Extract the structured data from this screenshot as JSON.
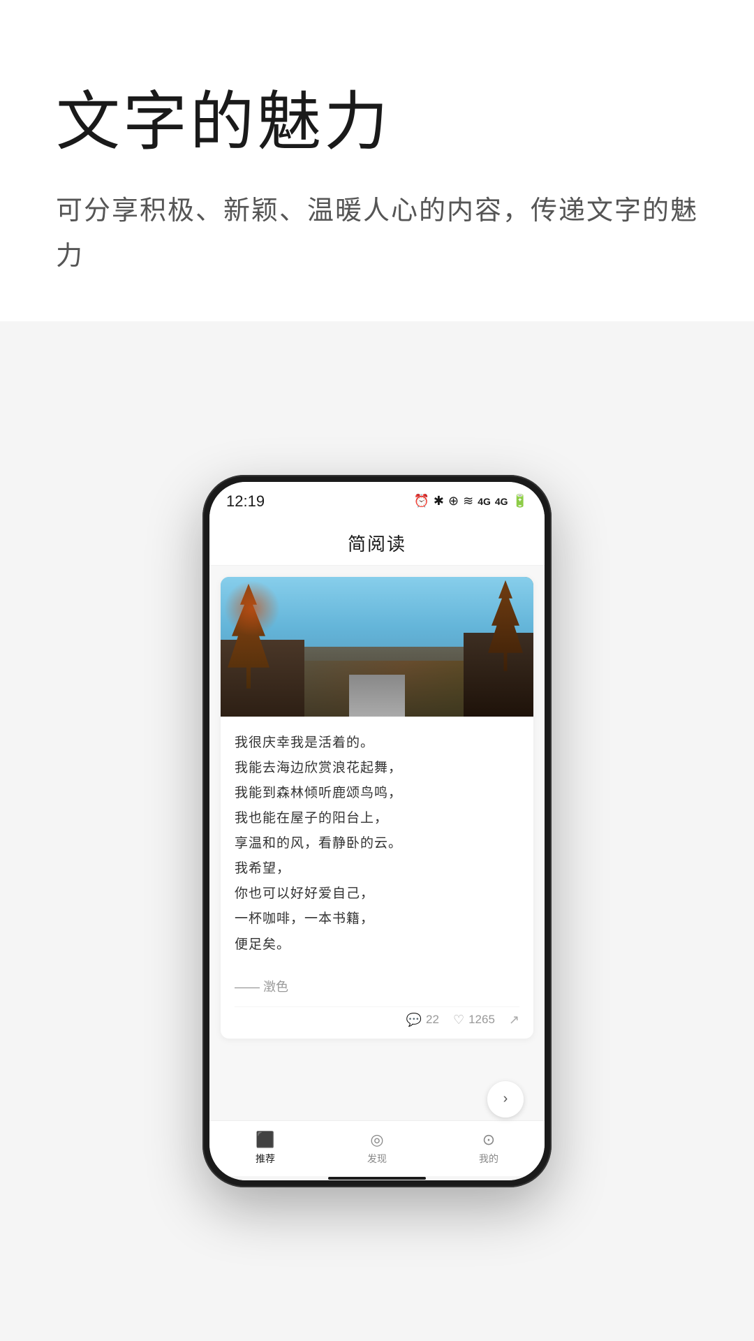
{
  "hero": {
    "title": "文字的魅力",
    "subtitle": "可分享积极、新颖、温暖人心的内容，传递文字的魅力"
  },
  "phone": {
    "statusBar": {
      "time": "12:19",
      "nfc": "N",
      "icons": "⏰ ✱ ⊕ ≋ 4G 4G 🔋"
    },
    "appTitle": "简阅读",
    "article": {
      "text_line1": "我很庆幸我是活着的。",
      "text_line2": "我能去海边欣赏浪花起舞，",
      "text_line3": "我能到森林倾听鹿颂鸟鸣，",
      "text_line4": "我也能在屋子的阳台上，",
      "text_line5": "享温和的风，看静卧的云。",
      "text_line6": "我希望，",
      "text_line7": "你也可以好好爱自己，",
      "text_line8": "一杯咖啡，一本书籍，",
      "text_line9": "便足矣。",
      "author": "—— 澂色",
      "comments": "22",
      "likes": "1265"
    },
    "nav": {
      "items": [
        {
          "icon": "📺",
          "label": "推荐",
          "active": true
        },
        {
          "icon": "🧭",
          "label": "发现",
          "active": false
        },
        {
          "icon": "👤",
          "label": "我的",
          "active": false
        }
      ]
    }
  }
}
